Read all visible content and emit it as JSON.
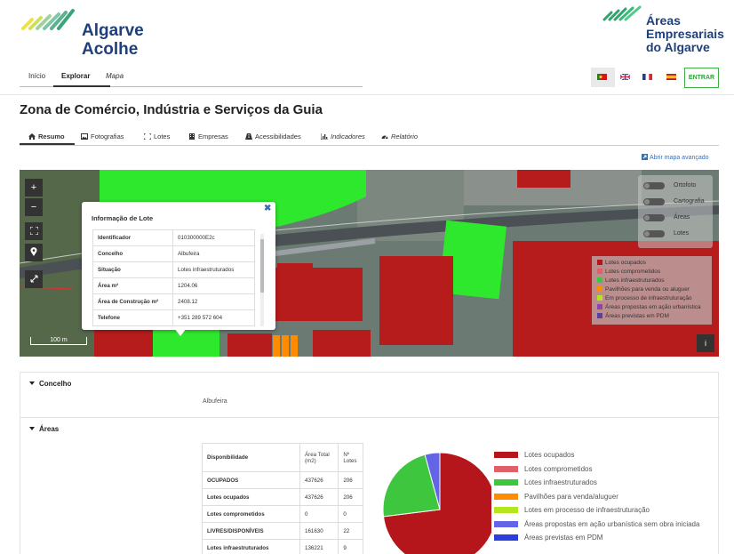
{
  "header": {
    "brand_left": "Algarve Acolhe",
    "brand_right": "Áreas Empresariais do Algarve",
    "nav": [
      "Início",
      "Explorar",
      "Mapa"
    ],
    "login_label": "ENTRAR",
    "languages": [
      "pt",
      "en",
      "fr",
      "es"
    ]
  },
  "page": {
    "title": "Zona de Comércio, Indústria e Serviços da Guia",
    "tabs": [
      "Resumo",
      "Fotografias",
      "Lotes",
      "Empresas",
      "Acessibilidades",
      "Indicadores",
      "Relatório"
    ],
    "advanced_map_link": "Abrir mapa avançado"
  },
  "map": {
    "scale_label": "100 m",
    "zoom_in": "+",
    "zoom_out": "−",
    "info_label": "i",
    "layers": [
      "Ortofoto",
      "Cartografia",
      "Áreas",
      "Lotes"
    ],
    "legend": [
      {
        "label": "Lotes ocupados",
        "color": "#b5161b"
      },
      {
        "label": "Lotes comprometidos",
        "color": "#e0606a"
      },
      {
        "label": "Lotes infraestruturados",
        "color": "#3ec63e"
      },
      {
        "label": "Pavilhões para venda ou aluguer",
        "color": "#ff8c00"
      },
      {
        "label": "Em processo de infraestruturação",
        "color": "#b5e61d"
      },
      {
        "label": "Áreas propostas em ação urbanística",
        "color": "#8e44ad"
      },
      {
        "label": "Áreas previstas em PDM",
        "color": "#5b3fa0"
      }
    ],
    "popup": {
      "title": "Informação de Lote",
      "close": "✖",
      "rows": [
        {
          "key": "Identificador",
          "value": "010300000E2c"
        },
        {
          "key": "Concelho",
          "value": "Albufeira"
        },
        {
          "key": "Situação",
          "value": "Lotes infraestruturados"
        },
        {
          "key": "Área m²",
          "value": "1204.06"
        },
        {
          "key": "Área de Construção m²",
          "value": "2408.12"
        },
        {
          "key": "Telefone",
          "value": "+351 289 572 604"
        }
      ]
    }
  },
  "sections": {
    "concelho": {
      "title": "Concelho",
      "value": "Albufeira"
    },
    "areas": {
      "title": "Áreas",
      "table": {
        "header": [
          "Disponibilidade",
          "Área Total (m2)",
          "Nº Lotes"
        ],
        "rows": [
          [
            "OCUPADOS",
            "437626",
            "206"
          ],
          [
            "Lotes ocupados",
            "437626",
            "206"
          ],
          [
            "Lotes comprometidos",
            "0",
            "0"
          ],
          [
            "LIVRES/DISPONÍVEIS",
            "161630",
            "22"
          ],
          [
            "Lotes infraestruturados",
            "136221",
            "9"
          ]
        ]
      }
    }
  },
  "chart_data": {
    "type": "pie",
    "categories": [
      "Lotes ocupados",
      "Lotes infraestruturados",
      "Áreas propostas em ação urbanística sem obra iniciada"
    ],
    "values": [
      437626,
      136221,
      25409
    ],
    "colors": [
      "#b5161b",
      "#3ec63e",
      "#6464e6"
    ],
    "legend": [
      {
        "label": "Lotes ocupados",
        "color": "#b5161b"
      },
      {
        "label": "Lotes comprometidos",
        "color": "#e0606a"
      },
      {
        "label": "Lotes infraestruturados",
        "color": "#3ec63e"
      },
      {
        "label": "Pavilhões para venda/aluguer",
        "color": "#ff8c00"
      },
      {
        "label": "Lotes em processo de infraestruturação",
        "color": "#b5e61d"
      },
      {
        "label": "Áreas propostas em ação urbanística sem obra iniciada",
        "color": "#6464e6"
      },
      {
        "label": "Áreas previstas em PDM",
        "color": "#2a3ee0"
      }
    ],
    "legend_position": "right"
  }
}
